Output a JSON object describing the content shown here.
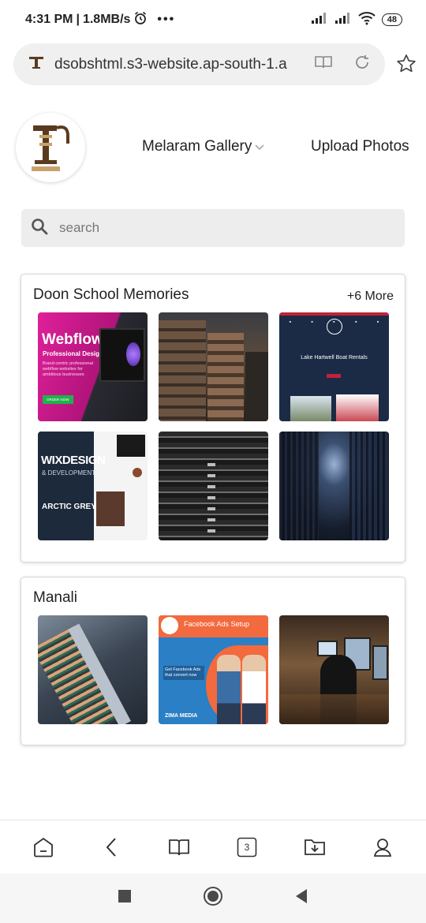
{
  "status_bar": {
    "time": "4:31 PM",
    "speed": "1.8MB/s",
    "battery": "48"
  },
  "browser": {
    "url": "dsobshtml.s3-website.ap-south-1.a",
    "tab_count": "3"
  },
  "header": {
    "gallery_label": "Melaram Gallery",
    "upload_label": "Upload Photos"
  },
  "search": {
    "placeholder": "search"
  },
  "albums": [
    {
      "title": "Doon School Memories",
      "more_label": "+6 More",
      "thumbnails": [
        {
          "name": "webflow-ad",
          "title": "Webflow",
          "subtitle": "Professional Design",
          "text": "Brand-centric professional webflow websites for ambitious businesses",
          "button": "ORDER NOW"
        },
        {
          "name": "city-buildings"
        },
        {
          "name": "boat-rentals",
          "title": "Lake Hartwell Boat Rentals"
        },
        {
          "name": "wix-design",
          "title": "WIXDESIGN",
          "subtitle": "& DEVELOPMENT",
          "brand": "ARCTIC GREY"
        },
        {
          "name": "server-rack"
        },
        {
          "name": "data-center"
        }
      ]
    },
    {
      "title": "Manali",
      "thumbnails": [
        {
          "name": "circuit-machine"
        },
        {
          "name": "facebook-ads",
          "title": "Facebook Ads Setup",
          "text": "Get Facebook Ads that convert now",
          "brand": "ZIMA MEDIA"
        },
        {
          "name": "editing-studio"
        }
      ]
    }
  ],
  "colors": {
    "webflow_magenta": "#e0209a",
    "fb_orange": "#f26a3d",
    "fb_blue": "#2b7fc4",
    "navy": "#1b2b45"
  }
}
